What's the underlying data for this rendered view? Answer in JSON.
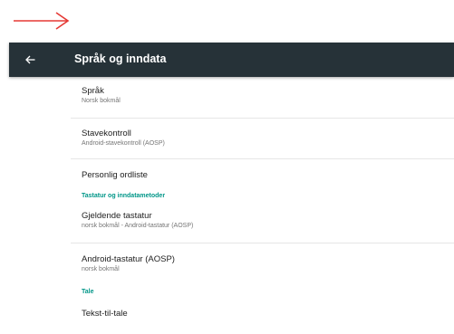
{
  "appbar": {
    "title": "Språk og inndata",
    "back_icon": "arrow-back-icon",
    "background": "#263238"
  },
  "annotation": {
    "icon": "red-arrow-right-icon",
    "color": "#e53935"
  },
  "accent_color": "#009688",
  "items": [
    {
      "title": "Språk",
      "summary": "Norsk bokmål"
    },
    {
      "title": "Stavekontroll",
      "summary": "Android-stavekontroll (AOSP)"
    },
    {
      "title": "Personlig ordliste"
    }
  ],
  "keyboard_section": {
    "header": "Tastatur og inndatametoder",
    "items": [
      {
        "title": "Gjeldende tastatur",
        "summary": "norsk bokmål - Android-tastatur (AOSP)"
      },
      {
        "title": "Android-tastatur (AOSP)",
        "summary": "norsk bokmål"
      }
    ]
  },
  "speech_section": {
    "header": "Tale",
    "items": [
      {
        "title": "Tekst-til-tale"
      }
    ]
  }
}
